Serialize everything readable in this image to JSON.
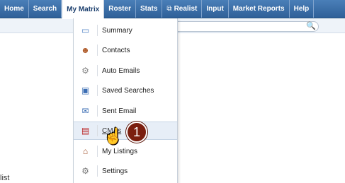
{
  "nav": {
    "items": [
      {
        "label": "Home"
      },
      {
        "label": "Search"
      },
      {
        "label": "My Matrix"
      },
      {
        "label": "Roster"
      },
      {
        "label": "Stats"
      },
      {
        "label": "Realist",
        "icon": "realist-icon"
      },
      {
        "label": "Input"
      },
      {
        "label": "Market Reports"
      },
      {
        "label": "Help"
      }
    ],
    "active": "My Matrix"
  },
  "dropdown": {
    "items": [
      {
        "label": "Summary",
        "icon": "summary-icon"
      },
      {
        "label": "Contacts",
        "icon": "contacts-icon"
      },
      {
        "label": "Auto Emails",
        "icon": "auto-emails-icon"
      },
      {
        "label": "Saved Searches",
        "icon": "saved-searches-icon"
      },
      {
        "label": "Sent Email",
        "icon": "sent-email-icon"
      },
      {
        "label": "CMAs",
        "icon": "cma-icon"
      },
      {
        "label": "My Listings",
        "icon": "my-listings-icon"
      },
      {
        "label": "Settings",
        "icon": "settings-icon"
      }
    ],
    "highlighted": "CMAs"
  },
  "step_badge": {
    "number": "1"
  },
  "background": {
    "partial_text": "list"
  },
  "colors": {
    "nav_bg": "#2f6098",
    "badge": "#7b1e0f",
    "highlight": "#e7eef7"
  }
}
